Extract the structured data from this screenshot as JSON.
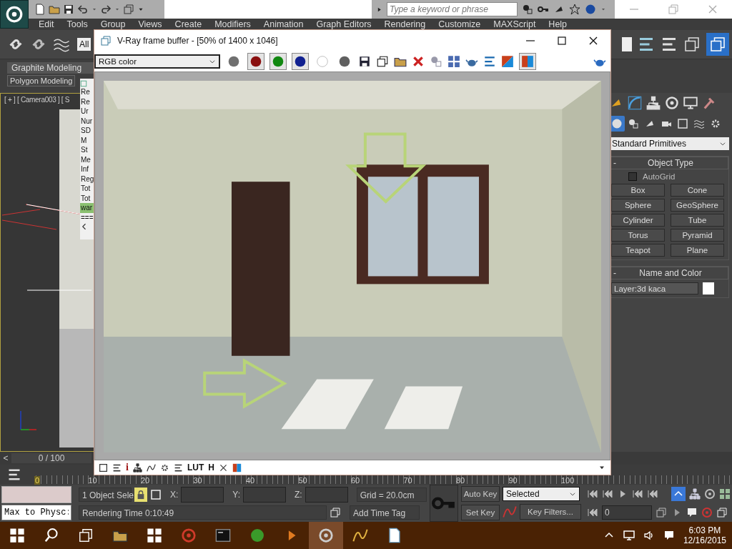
{
  "title_bar": {
    "search": {
      "placeholder": "Type a keyword or phrase"
    }
  },
  "menu": [
    "Edit",
    "Tools",
    "Group",
    "Views",
    "Create",
    "Modifiers",
    "Animation",
    "Graph Editors",
    "Rendering",
    "Customize",
    "MAXScript",
    "Help"
  ],
  "toolbar": {
    "selection_filter": "All"
  },
  "ribbon": {
    "tab": "Graphite Modeling",
    "panel": "Polygon Modeling"
  },
  "viewport": {
    "label": "[ + ] [ Camera003 ] [ S"
  },
  "listener": {
    "lines": [
      {
        "text": "Re",
        "highlighted": false
      },
      {
        "text": "Re",
        "highlighted": false
      },
      {
        "text": "Ur",
        "highlighted": false
      },
      {
        "text": "Nur",
        "highlighted": false
      },
      {
        "text": "SD",
        "highlighted": false
      },
      {
        "text": "M",
        "highlighted": false
      },
      {
        "text": "St",
        "highlighted": false
      },
      {
        "text": "Me",
        "highlighted": false
      },
      {
        "text": "Inf",
        "highlighted": false
      },
      {
        "text": "Reg",
        "highlighted": false
      },
      {
        "text": "Tot",
        "highlighted": false
      },
      {
        "text": "Tot",
        "highlighted": false
      },
      {
        "text": "war",
        "highlighted": true
      },
      {
        "text": "===",
        "highlighted": false
      }
    ]
  },
  "frame_buffer": {
    "title": "V-Ray frame buffer - [50% of 1400 x 1046]",
    "channel": "RGB color",
    "channel_buttons": [
      {
        "kind": "rgb",
        "selected": false
      },
      {
        "kind": "red",
        "selected": true
      },
      {
        "kind": "green",
        "selected": true
      },
      {
        "kind": "blue",
        "selected": true
      },
      {
        "kind": "mono",
        "selected": false
      },
      {
        "kind": "alpha",
        "selected": false
      }
    ],
    "compare_ab_selected": true,
    "bottom_tools": [
      {
        "kind": "icon"
      },
      {
        "kind": "icon"
      },
      {
        "kind": "text",
        "label": "i"
      },
      {
        "kind": "icon"
      },
      {
        "kind": "icon"
      },
      {
        "kind": "icon"
      },
      {
        "kind": "icon"
      },
      {
        "kind": "text",
        "label": "LUT"
      },
      {
        "kind": "text",
        "label": "H"
      },
      {
        "kind": "icon"
      },
      {
        "kind": "icon"
      }
    ]
  },
  "timeline": {
    "prev": "<",
    "position": "0 / 100",
    "level": 0,
    "ticks": [
      "0",
      "10",
      "20",
      "30",
      "40",
      "50",
      "60",
      "70",
      "80",
      "90",
      "100"
    ]
  },
  "command_panel": {
    "categories": [
      {
        "selected": true
      },
      {
        "selected": false
      },
      {
        "selected": false
      },
      {
        "selected": false
      },
      {
        "selected": false
      },
      {
        "selected": false
      },
      {
        "selected": false
      }
    ],
    "object_class": "Standard Primitives",
    "object_type": {
      "collapse": "-",
      "title": "Object Type",
      "autogrid": {
        "label": "AutoGrid",
        "checked": false
      },
      "buttons": [
        "Box",
        "Cone",
        "Sphere",
        "GeoSphere",
        "Cylinder",
        "Tube",
        "Torus",
        "Pyramid",
        "Teapot",
        "Plane"
      ]
    },
    "name_and_color": {
      "collapse": "-",
      "title": "Name and Color",
      "name": "Layer:3d kaca"
    }
  },
  "status": {
    "script_field": "Max to Physc:",
    "selection": "1 Object Sele",
    "lock_on": true,
    "x_label": "X:",
    "y_label": "Y:",
    "z_label": "Z:",
    "grid": "Grid = 20.0cm",
    "prompt": "Rendering Time  0:10:49",
    "add_time_tag": "Add Time Tag",
    "auto_key": "Auto Key",
    "set_key": "Set Key",
    "key_mode": "Selected",
    "key_filters": "Key Filters...",
    "frame": "0"
  },
  "taskbar": {
    "time": "6:03 PM",
    "date": "12/16/2015"
  }
}
